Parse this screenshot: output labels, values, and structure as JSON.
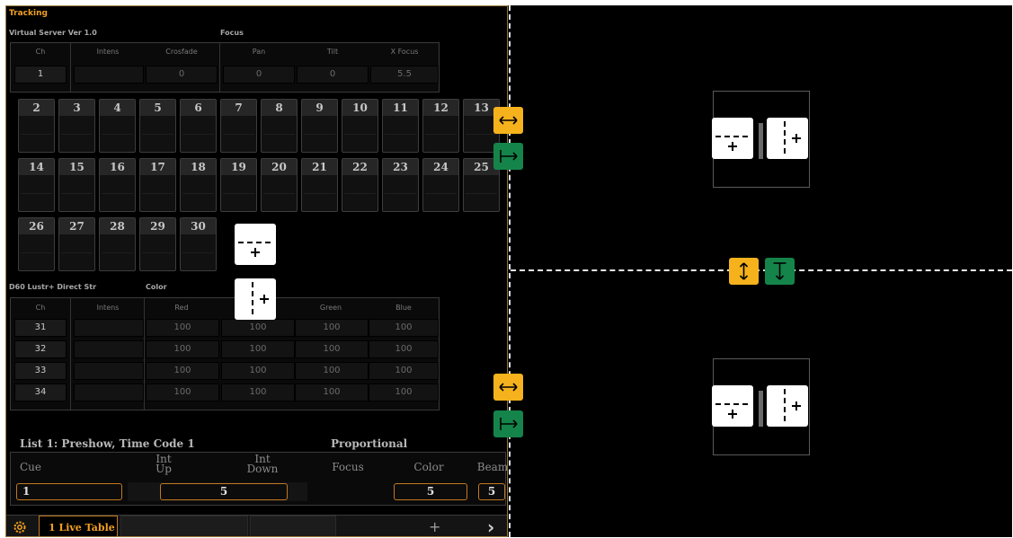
{
  "left_pane": {
    "title": "Tracking",
    "fixture_1": {
      "label": "Virtual Server Ver 1.0",
      "section": "Focus",
      "headers": [
        "Ch",
        "Intens",
        "Crosfade",
        "Pan",
        "Tilt",
        "X Focus"
      ],
      "row": {
        "ch": "1",
        "intens": "",
        "crosfade": "0",
        "pan": "0",
        "tilt": "0",
        "x_focus": "5.5"
      }
    },
    "tiles": [
      "2",
      "3",
      "4",
      "5",
      "6",
      "7",
      "8",
      "9",
      "10",
      "11",
      "12",
      "13",
      "14",
      "15",
      "16",
      "17",
      "18",
      "19",
      "20",
      "21",
      "22",
      "23",
      "24",
      "25",
      "26",
      "27",
      "28",
      "29",
      "30"
    ],
    "fixture_2": {
      "label": "D60 Lustr+ Direct Str",
      "section": "Color",
      "headers": [
        "Ch",
        "Intens",
        "Red",
        "Green",
        "Blue"
      ],
      "rows": [
        {
          "ch": "31",
          "red": "100",
          "c2": "100",
          "green": "100",
          "blue": "100"
        },
        {
          "ch": "32",
          "red": "100",
          "c2": "100",
          "green": "100",
          "blue": "100"
        },
        {
          "ch": "33",
          "red": "100",
          "c2": "100",
          "green": "100",
          "blue": "100"
        },
        {
          "ch": "34",
          "red": "100",
          "c2": "100",
          "green": "100",
          "blue": "100"
        }
      ]
    },
    "cue_list": {
      "title": "List 1: Preshow, Time Code 1",
      "mode": "Proportional",
      "headers": {
        "cue": "Cue",
        "int_up": "Int\nUp",
        "int_down": "Int\nDown",
        "focus": "Focus",
        "color": "Color",
        "beam": "Beam"
      },
      "values": {
        "cue": "1",
        "int_updown": "5",
        "color": "5",
        "beam": "5"
      }
    },
    "tabs": {
      "active": "1 Live Table",
      "add": "+",
      "next": "›"
    }
  },
  "icons": {
    "gear": "gear-icon",
    "split_horizontal": "split-horizontal-icon",
    "split_vertical": "split-vertical-icon",
    "resize_horizontal": "arrow-left-right-icon",
    "snap_right": "arrow-to-right-icon",
    "resize_vertical": "arrow-up-down-icon",
    "snap_down": "arrow-to-bottom-icon"
  },
  "colors": {
    "accent_orange": "#f5b21c",
    "accent_green": "#15844a",
    "tab_active": "#f0a020",
    "background": "#000000"
  }
}
